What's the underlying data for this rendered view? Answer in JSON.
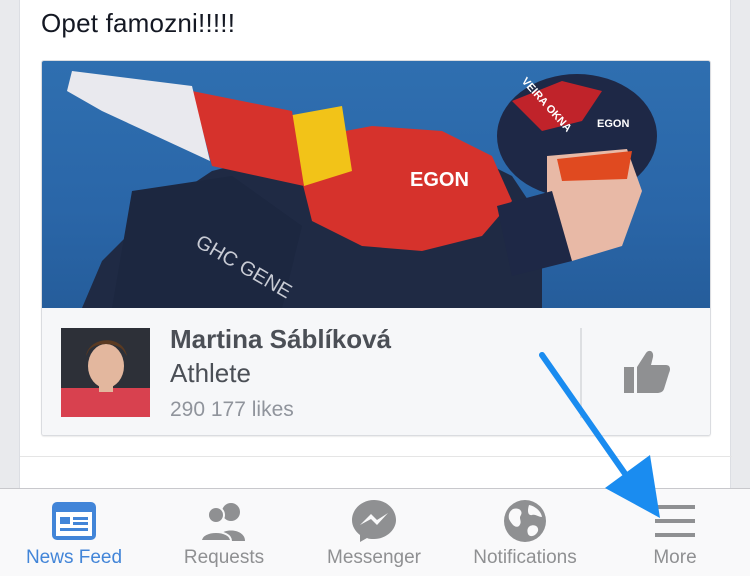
{
  "post": {
    "text": "Opet famozni!!!!!"
  },
  "shared_page": {
    "name": "Martina Sáblíková",
    "category": "Athlete",
    "likes": "290 177 likes",
    "cover_text": {
      "egon_helmet": "EGON",
      "egon_chest": "EGON",
      "sponsor": "GHC GENE",
      "helmet_brand": "VEIRA OKNA"
    }
  },
  "tabbar": {
    "tabs": [
      {
        "label": "News Feed",
        "icon": "news-feed-icon",
        "active": true
      },
      {
        "label": "Requests",
        "icon": "friend-requests-icon",
        "active": false
      },
      {
        "label": "Messenger",
        "icon": "messenger-icon",
        "active": false
      },
      {
        "label": "Notifications",
        "icon": "globe-icon",
        "active": false
      },
      {
        "label": "More",
        "icon": "hamburger-menu-icon",
        "active": false
      }
    ]
  },
  "colors": {
    "active": "#4285d8",
    "inactive": "#8f9092",
    "arrow": "#1a8cf0"
  }
}
